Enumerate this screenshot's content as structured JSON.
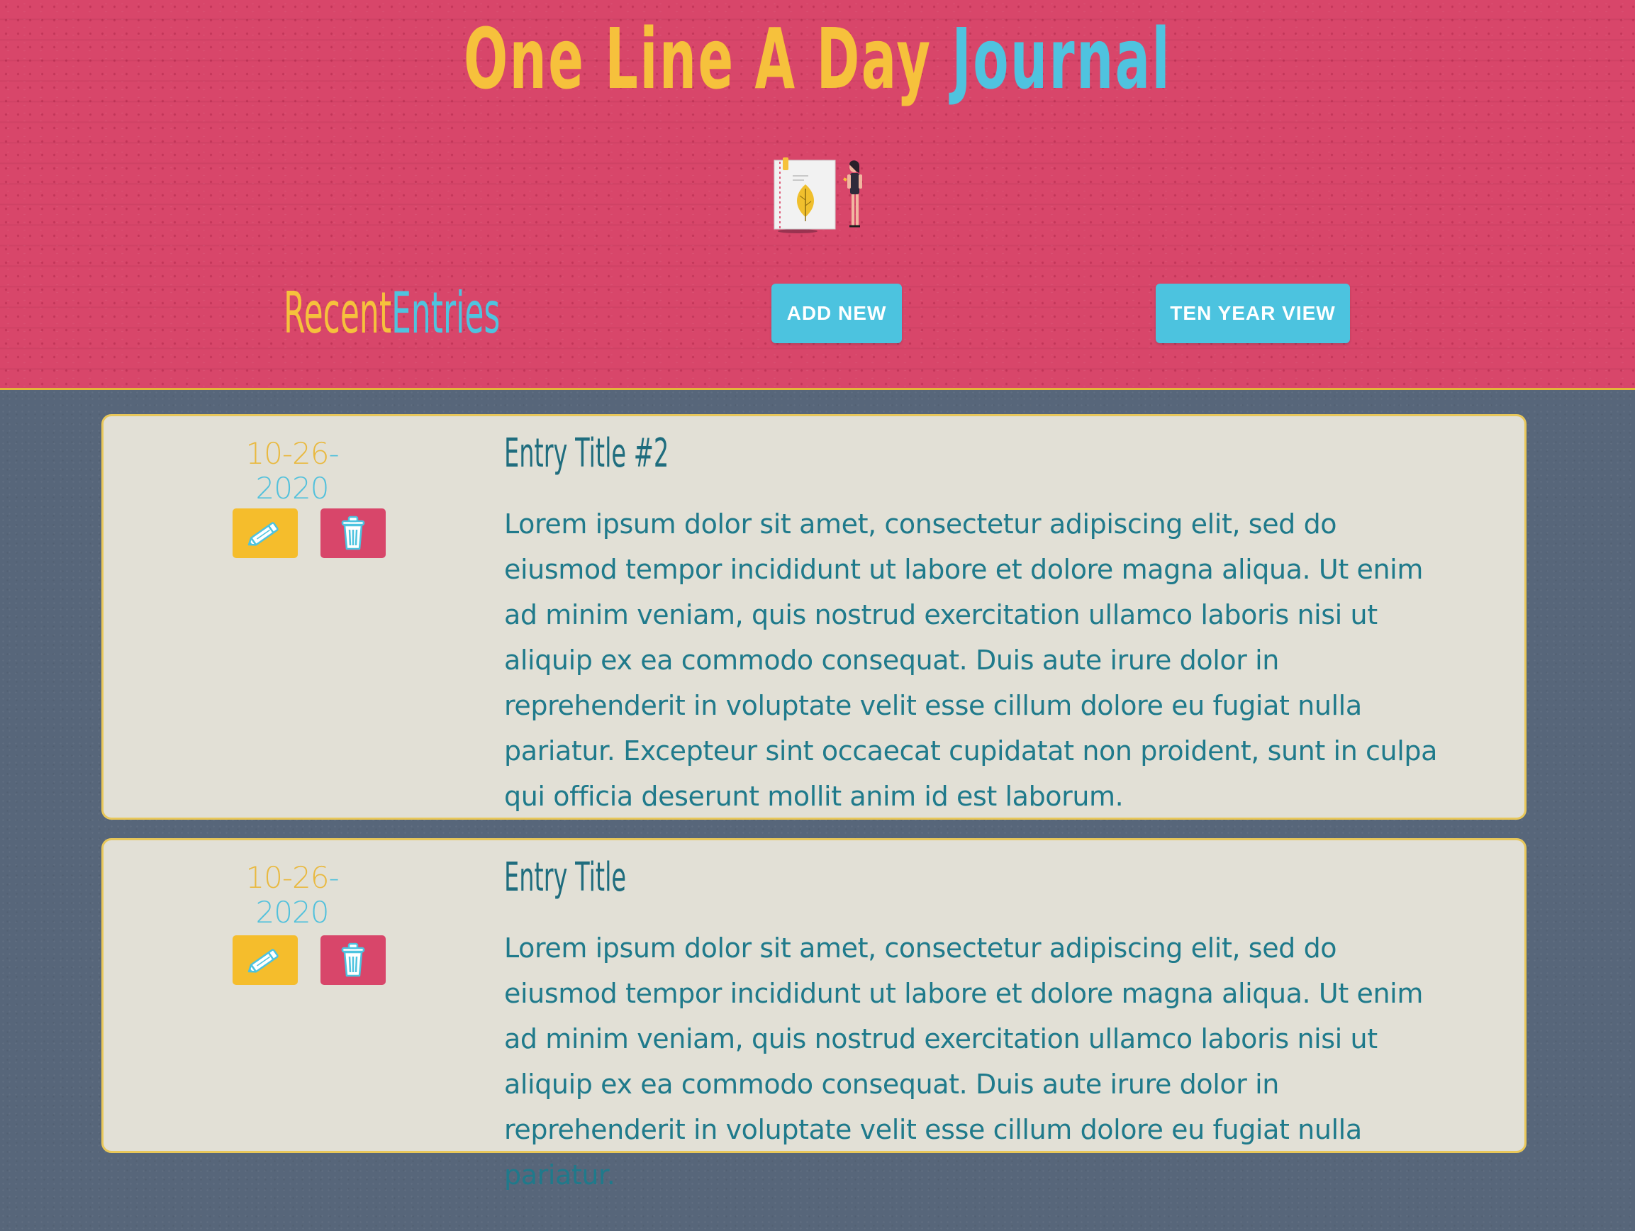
{
  "app": {
    "title_part1": "One Line A Day",
    "title_part2": "Journal"
  },
  "nav": {
    "recent_part1": "Recent",
    "recent_part2": "Entries",
    "add_new_label": "ADD NEW",
    "ten_year_label": "TEN YEAR VIEW"
  },
  "colors": {
    "header_bg": "#d8466a",
    "accent_yellow": "#f6c13c",
    "accent_blue": "#4fc3df",
    "page_bg": "#57667a",
    "card_bg": "#e2e0d6",
    "text_teal": "#1f7a8b"
  },
  "entries": [
    {
      "date_month": "10",
      "date_day": "26",
      "date_year": "2020",
      "title": "Entry Title #2",
      "body": "Lorem ipsum dolor sit amet, consectetur adipiscing elit, sed do eiusmod tempor incididunt ut labore et dolore magna aliqua. Ut enim ad minim veniam, quis nostrud exercitation ullamco laboris nisi ut aliquip ex ea commodo consequat. Duis aute irure dolor in reprehenderit in voluptate velit esse cillum dolore eu fugiat nulla pariatur. Excepteur sint occaecat cupidatat non proident, sunt in culpa qui officia deserunt mollit anim id est laborum.",
      "edit_icon": "pencil-icon",
      "delete_icon": "trash-icon"
    },
    {
      "date_month": "10",
      "date_day": "26",
      "date_year": "2020",
      "title": "Entry Title",
      "body": "Lorem ipsum dolor sit amet, consectetur adipiscing elit, sed do eiusmod tempor incididunt ut labore et dolore magna aliqua. Ut enim ad minim veniam, quis nostrud exercitation ullamco laboris nisi ut aliquip ex ea commodo consequat. Duis aute irure dolor in reprehenderit in voluptate velit esse cillum dolore eu fugiat nulla pariatur.",
      "edit_icon": "pencil-icon",
      "delete_icon": "trash-icon"
    }
  ],
  "illustration": "journal-notebook-and-woman-illustration"
}
